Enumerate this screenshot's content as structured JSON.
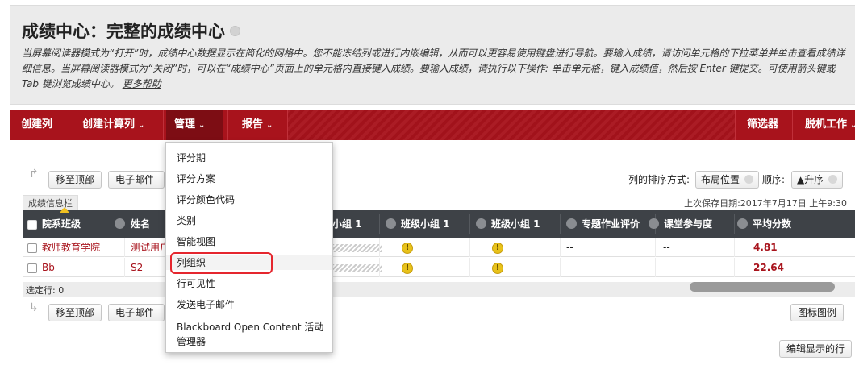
{
  "page": {
    "title": "成绩中心：完整的成绩中心",
    "description": "当屏幕阅读器模式为“打开”时，成绩中心数据显示在简化的网格中。您不能冻结列或进行内嵌编辑，从而可以更容易使用键盘进行导航。要输入成绩，请访问单元格的下拉菜单并单击查看成绩详细信息。当屏幕阅读器模式为“关闭”时，可以在“成绩中心”页面上的单元格内直接键入成绩。要输入成绩，请执行以下操作: 单击单元格，键入成绩值，然后按 Enter 键提交。可使用箭头键或 Tab 键浏览成绩中心。",
    "help_link": "更多帮助"
  },
  "nav": {
    "create_column": "创建列",
    "create_calc_column": "创建计算列",
    "manage": "管理",
    "reports": "报告",
    "filter": "筛选器",
    "offline": "脱机工作"
  },
  "menu": {
    "items": [
      "评分期",
      "评分方案",
      "评分颜色代码",
      "类别",
      "智能视图",
      "列组织",
      "行可见性",
      "发送电子邮件",
      "Blackboard Open Content 活动管理器"
    ],
    "highlighted": "列组织"
  },
  "toolbar": {
    "move_top": "移至顶部",
    "email": "电子邮件",
    "sort_label": "列的排序方式:",
    "sort_value": "布局位置",
    "order_label": "顺序:",
    "order_value": "▲升序"
  },
  "grid": {
    "info_tab": "成绩信息栏",
    "saved": "上次保存日期:2017年7月17日 上午9:30",
    "headers": [
      "院系班级",
      "姓名",
      "小组 1",
      "班级小组 1",
      "班级小组 1",
      "专题作业评价",
      "课堂参与度",
      "平均分数"
    ],
    "rows": [
      {
        "dept": "教师教育学院",
        "name": "测试用户",
        "c5": "--",
        "c6": "--",
        "avg": "4.81"
      },
      {
        "dept": "Bb",
        "name": "S2",
        "c5": "--",
        "c6": "--",
        "avg": "22.64"
      }
    ],
    "selected": "选定行: 0"
  },
  "bottom": {
    "legend": "图标图例",
    "edit_rows": "编辑显示的行"
  },
  "colors": {
    "nav_bg": "#a8131c",
    "header_bg": "#3e4247",
    "highlight_border": "#e5262e"
  }
}
